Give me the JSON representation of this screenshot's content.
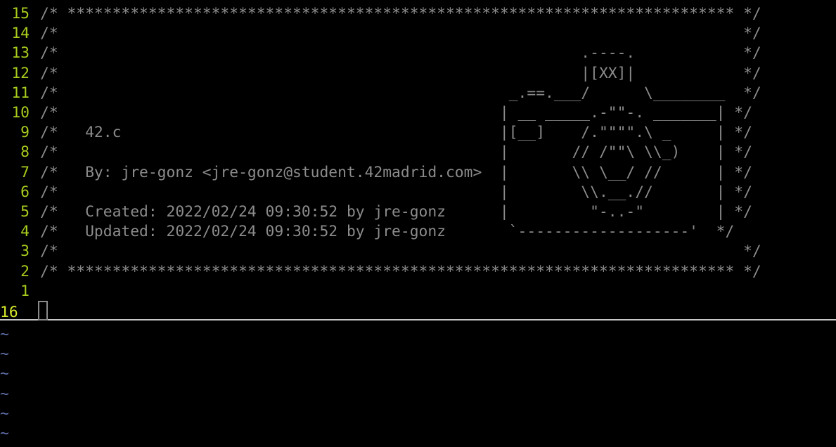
{
  "editor": {
    "lines": [
      {
        "num": "15",
        "text": "/* ************************************************************************** */"
      },
      {
        "num": "14",
        "text": "/*                                                                            */"
      },
      {
        "num": "13",
        "text": "/*                                                          .----.            */"
      },
      {
        "num": "12",
        "text": "/*                                                          |[XX]|            */"
      },
      {
        "num": "11",
        "text": "/*                                                  _.==.___/      \\________  */"
      },
      {
        "num": "10",
        "text": "/*                                                 | __ _____.-\"\"-. _______| */"
      },
      {
        "num": "9",
        "text": "/*   42.c                                          |[__]    /.\"\"\"\".\\ _     | */"
      },
      {
        "num": "8",
        "text": "/*                                                 |       // /\"\"\\ \\\\_)    | */"
      },
      {
        "num": "7",
        "text": "/*   By: jre-gonz <jre-gonz@student.42madrid.com>  |       \\\\ \\__/ //      | */"
      },
      {
        "num": "6",
        "text": "/*                                                 |        \\\\.__.//       | */"
      },
      {
        "num": "5",
        "text": "/*   Created: 2022/02/24 09:30:52 by jre-gonz      |         \"-..-\"        | */"
      },
      {
        "num": "4",
        "text": "/*   Updated: 2022/02/24 09:30:52 by jre-gonz       `-------------------'  */"
      },
      {
        "num": "3",
        "text": "/*                                                                            */"
      },
      {
        "num": "2",
        "text": "/* ************************************************************************** */"
      },
      {
        "num": "1",
        "text": ""
      }
    ],
    "current_line": {
      "num": "16",
      "text": ""
    },
    "tildes": [
      "~",
      "~",
      "~",
      "~",
      "~",
      "~"
    ]
  },
  "colors": {
    "background": "#000000",
    "line_number": "#a8cc1e",
    "current_line_number": "#d7ea2a",
    "text": "#8c8c8c",
    "tilde": "#5f6fa8"
  }
}
